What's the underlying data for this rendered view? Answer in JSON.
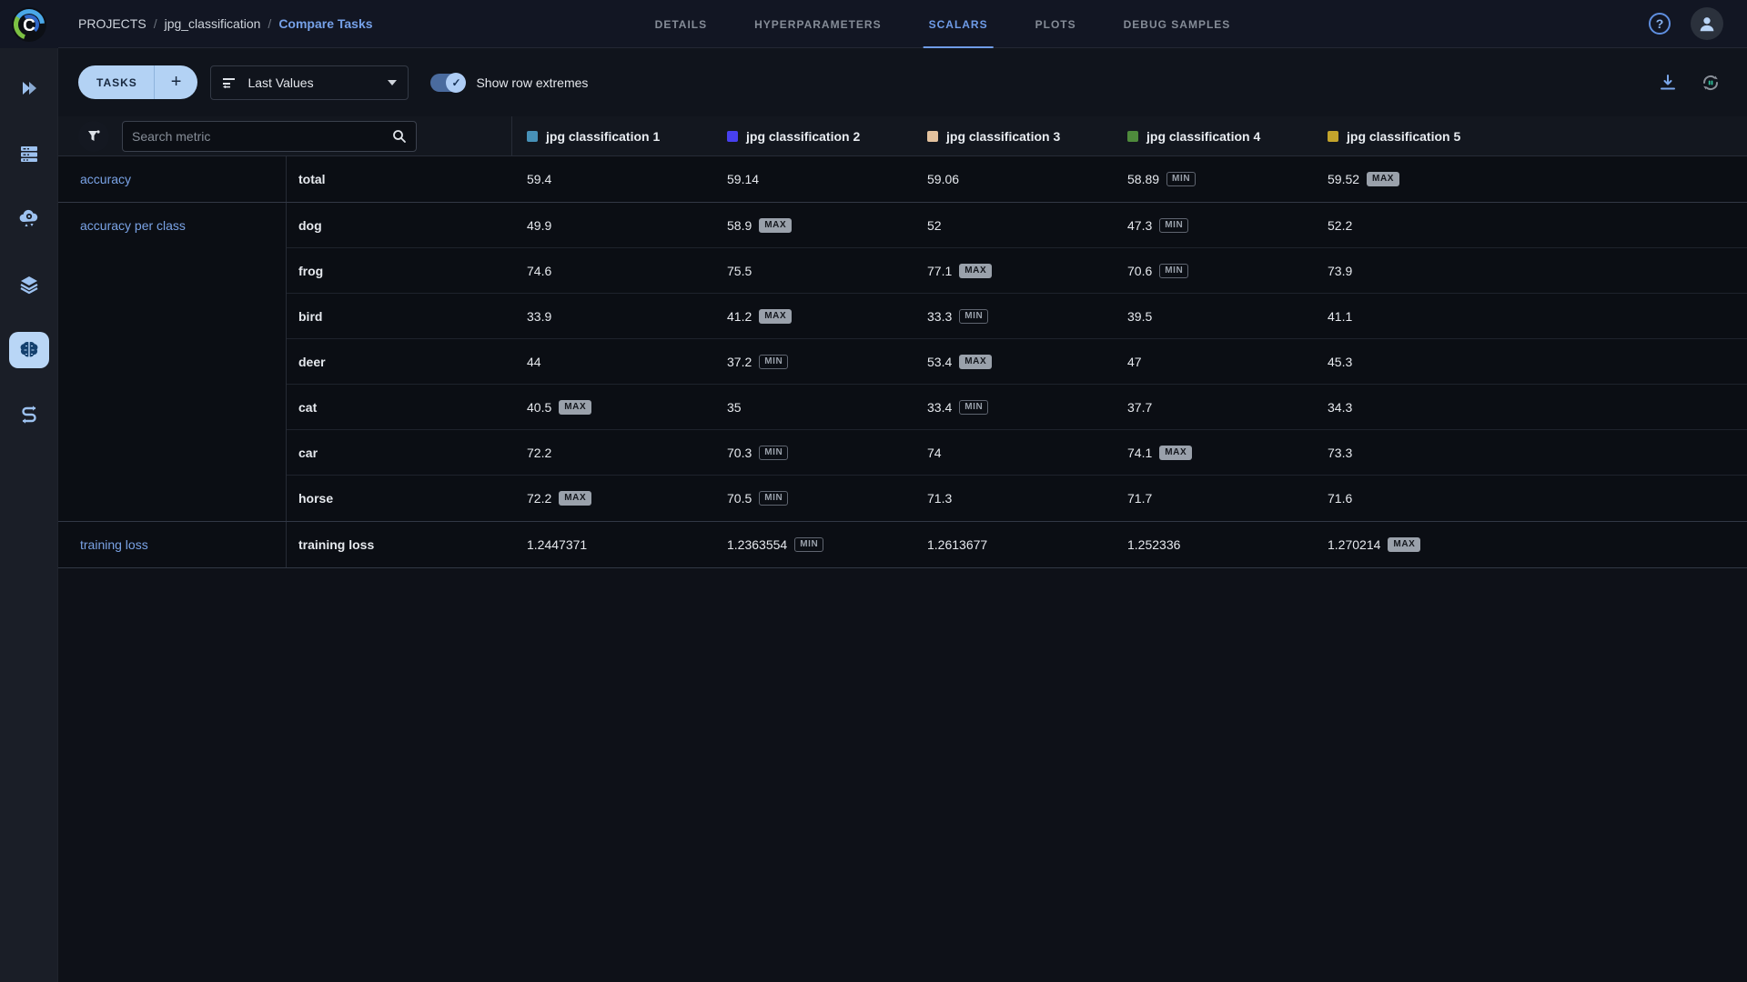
{
  "brand": {
    "logo_letter": "C"
  },
  "header": {
    "breadcrumb": {
      "items": [
        "PROJECTS",
        "jpg_classification"
      ],
      "current": "Compare Tasks",
      "separator": "/"
    },
    "tabs": [
      {
        "label": "DETAILS",
        "active": false
      },
      {
        "label": "HYPERPARAMETERS",
        "active": false
      },
      {
        "label": "SCALARS",
        "active": true
      },
      {
        "label": "PLOTS",
        "active": false
      },
      {
        "label": "DEBUG SAMPLES",
        "active": false
      }
    ],
    "help_glyph": "?"
  },
  "toolbar": {
    "tasks_button_label": "TASKS",
    "add_task_label": "+",
    "values_mode": "Last Values",
    "show_row_extremes_label": "Show row extremes",
    "toggle_on": true,
    "toggle_check_glyph": "✓"
  },
  "theme": {
    "accent": "#76a1e8",
    "badge_max_bg": "#9aa1ab",
    "badge_min_border": "#5f6570",
    "active_nav_bg": "#b9d6f6"
  },
  "icons": {
    "sidebar": [
      "projects-icon",
      "workers-queues-icon",
      "applications-icon",
      "datasets-icon",
      "models-brain-icon",
      "pipelines-icon"
    ],
    "topbar": [
      "help-icon",
      "user-avatar-icon"
    ],
    "toolbar": [
      "sort-icon",
      "caret-down-icon",
      "download-icon",
      "auto-refresh-icon"
    ],
    "table": [
      "filter-icon",
      "search-icon"
    ]
  },
  "metrics_table": {
    "search_placeholder": "Search metric",
    "experiments": [
      {
        "name": "jpg classification 1",
        "color": "#4791b8"
      },
      {
        "name": "jpg classification 2",
        "color": "#4740ef"
      },
      {
        "name": "jpg classification 3",
        "color": "#e3c29e"
      },
      {
        "name": "jpg classification 4",
        "color": "#4e8a3c"
      },
      {
        "name": "jpg classification 5",
        "color": "#c3a42c"
      }
    ],
    "groups": [
      {
        "metric": "accuracy",
        "rows": [
          {
            "variant": "total",
            "values": [
              {
                "v": "59.4"
              },
              {
                "v": "59.14"
              },
              {
                "v": "59.06"
              },
              {
                "v": "58.89",
                "badge": "MIN"
              },
              {
                "v": "59.52",
                "badge": "MAX"
              }
            ]
          }
        ]
      },
      {
        "metric": "accuracy per class",
        "rows": [
          {
            "variant": "dog",
            "values": [
              {
                "v": "49.9"
              },
              {
                "v": "58.9",
                "badge": "MAX"
              },
              {
                "v": "52"
              },
              {
                "v": "47.3",
                "badge": "MIN"
              },
              {
                "v": "52.2"
              }
            ]
          },
          {
            "variant": "frog",
            "values": [
              {
                "v": "74.6"
              },
              {
                "v": "75.5"
              },
              {
                "v": "77.1",
                "badge": "MAX"
              },
              {
                "v": "70.6",
                "badge": "MIN"
              },
              {
                "v": "73.9"
              }
            ]
          },
          {
            "variant": "bird",
            "values": [
              {
                "v": "33.9"
              },
              {
                "v": "41.2",
                "badge": "MAX"
              },
              {
                "v": "33.3",
                "badge": "MIN"
              },
              {
                "v": "39.5"
              },
              {
                "v": "41.1"
              }
            ]
          },
          {
            "variant": "deer",
            "values": [
              {
                "v": "44"
              },
              {
                "v": "37.2",
                "badge": "MIN"
              },
              {
                "v": "53.4",
                "badge": "MAX"
              },
              {
                "v": "47"
              },
              {
                "v": "45.3"
              }
            ]
          },
          {
            "variant": "cat",
            "values": [
              {
                "v": "40.5",
                "badge": "MAX"
              },
              {
                "v": "35"
              },
              {
                "v": "33.4",
                "badge": "MIN"
              },
              {
                "v": "37.7"
              },
              {
                "v": "34.3"
              }
            ]
          },
          {
            "variant": "car",
            "values": [
              {
                "v": "72.2"
              },
              {
                "v": "70.3",
                "badge": "MIN"
              },
              {
                "v": "74"
              },
              {
                "v": "74.1",
                "badge": "MAX"
              },
              {
                "v": "73.3"
              }
            ]
          },
          {
            "variant": "horse",
            "values": [
              {
                "v": "72.2",
                "badge": "MAX"
              },
              {
                "v": "70.5",
                "badge": "MIN"
              },
              {
                "v": "71.3"
              },
              {
                "v": "71.7"
              },
              {
                "v": "71.6"
              }
            ]
          }
        ]
      },
      {
        "metric": "training loss",
        "rows": [
          {
            "variant": "training loss",
            "values": [
              {
                "v": "1.2447371"
              },
              {
                "v": "1.2363554",
                "badge": "MIN"
              },
              {
                "v": "1.2613677"
              },
              {
                "v": "1.252336"
              },
              {
                "v": "1.270214",
                "badge": "MAX"
              }
            ]
          }
        ]
      }
    ]
  }
}
